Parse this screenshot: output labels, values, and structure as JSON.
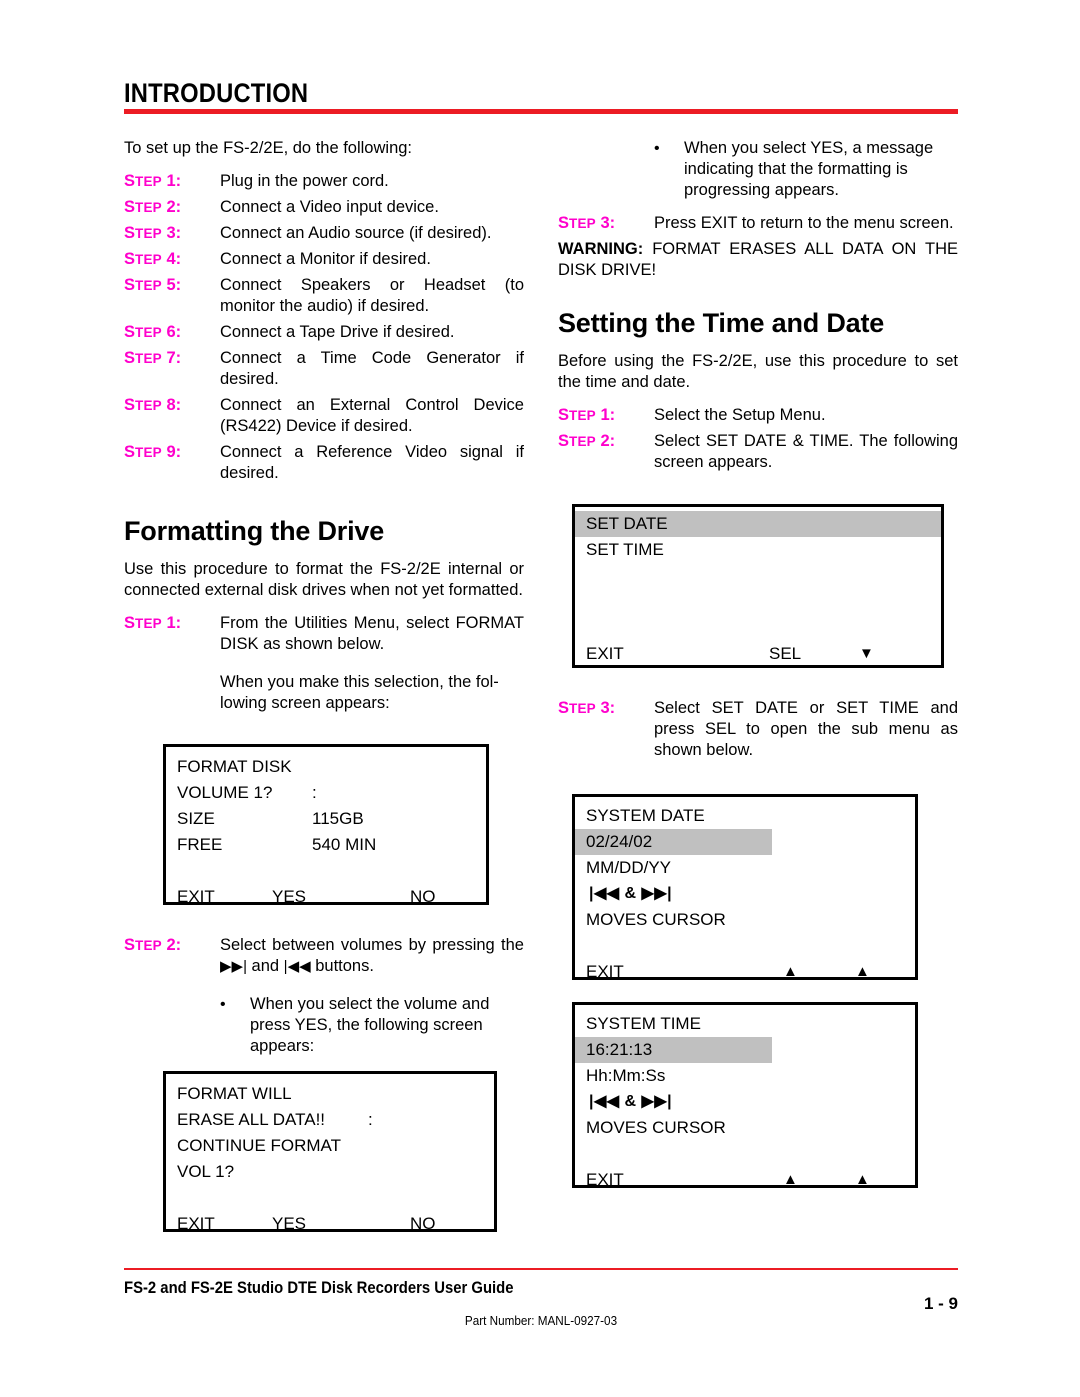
{
  "header": {
    "title": "INTRODUCTION",
    "rule_color": "#ec1c24"
  },
  "colors": {
    "step_magenta": "#ff00cc",
    "rule_red": "#ec1c24",
    "lcd_highlight": "#c0c0c0"
  },
  "left_column": {
    "intro_text": "To set up the FS-2/2E, do the following:",
    "setup_steps": [
      {
        "label_s": "S",
        "label_rest": "TEP",
        "num": "1:",
        "text": "Plug in the power cord."
      },
      {
        "label_s": "S",
        "label_rest": "TEP",
        "num": "2:",
        "text": "Connect a Video input device."
      },
      {
        "label_s": "S",
        "label_rest": "TEP",
        "num": "3:",
        "text": "Connect an Audio source (if desired)."
      },
      {
        "label_s": "S",
        "label_rest": "TEP",
        "num": "4:",
        "text": "Connect a Monitor if desired."
      },
      {
        "label_s": "S",
        "label_rest": "TEP",
        "num": "5:",
        "text": "Connect Speakers or Headset (to monitor the audio) if desired."
      },
      {
        "label_s": "S",
        "label_rest": "TEP",
        "num": "6:",
        "text": "Connect a Tape Drive if desired."
      },
      {
        "label_s": "S",
        "label_rest": "TEP",
        "num": "7:",
        "text": "Connect a Time Code Generator if desired."
      },
      {
        "label_s": "S",
        "label_rest": "TEP",
        "num": "8:",
        "text": "Connect an External Control Device (RS422) Device if desired."
      },
      {
        "label_s": "S",
        "label_rest": "TEP",
        "num": "9:",
        "text": "Connect a Reference Video signal if desired."
      }
    ],
    "formatting_heading": "Formatting the Drive",
    "formatting_intro": "Use this procedure to format the FS-2/2E internal or connected external disk drives when not yet formatted.",
    "format_step1": {
      "label_s": "S",
      "label_rest": "TEP",
      "num": "1:",
      "text": "From the Utilities Menu, select FORMAT DISK as shown below.",
      "continuation": "When you make this selection, the fol-lowing screen appears:"
    },
    "format_disk_screen": {
      "title": "FORMAT DISK",
      "rows": [
        {
          "c1": "VOLUME 1?",
          "c2": ":",
          "c3": ""
        },
        {
          "c1": "SIZE",
          "c2": "115GB",
          "c3": ""
        },
        {
          "c1": "FREE",
          "c2": "540 MIN",
          "c3": ""
        }
      ],
      "buttons": {
        "exit": "EXIT",
        "yes": "YES",
        "no": "NO"
      }
    },
    "format_step2": {
      "label_s": "S",
      "label_rest": "TEP",
      "num": "2:",
      "text_a": "Select between volumes by pressing the ",
      "fwd_glyph": "▶▶|",
      "text_b": " and ",
      "rew_glyph": "|◀◀",
      "text_c": " buttons.",
      "bullet": "When you select the volume and press YES, the following screen appears:"
    },
    "format_will_screen": {
      "rows": [
        {
          "c1": "FORMAT WILL",
          "c2": "",
          "c3": ""
        },
        {
          "c1": "ERASE ALL DATA!!",
          "c2": ":",
          "c3": ""
        },
        {
          "c1": "CONTINUE FORMAT",
          "c2": "",
          "c3": ""
        },
        {
          "c1": "VOL 1?",
          "c2": "",
          "c3": ""
        }
      ],
      "buttons": {
        "exit": "EXIT",
        "yes": "YES",
        "no": "NO"
      }
    }
  },
  "right_column": {
    "top_bullet": "When you select YES, a message indicating that the formatting is progressing appears.",
    "format_step3": {
      "label_s": "S",
      "label_rest": "TEP",
      "num": "3:",
      "text": "Press EXIT to return to the menu screen."
    },
    "warning_label": "WARNING:",
    "warning_text": " FORMAT ERASES ALL DATA ON THE DISK DRIVE!",
    "time_heading": "Setting the Time and Date",
    "time_intro": "Before using the FS-2/2E, use this procedure to set the time and date.",
    "time_steps": [
      {
        "label_s": "S",
        "label_rest": "TEP",
        "num": "1:",
        "text": "Select the Setup Menu."
      },
      {
        "label_s": "S",
        "label_rest": "TEP",
        "num": "2:",
        "text": "Select SET DATE & TIME. The following screen appears."
      }
    ],
    "set_date_screen": {
      "row_selected": "SET DATE",
      "row_second": "SET TIME",
      "buttons": {
        "exit": "EXIT",
        "sel": "SEL",
        "arrow": "▼"
      }
    },
    "time_step3": {
      "label_s": "S",
      "label_rest": "TEP",
      "num": "3:",
      "text": "Select SET DATE or SET TIME and press SEL to open the sub menu as shown below."
    },
    "system_date_screen": {
      "title": "SYSTEM DATE",
      "value": "02/24/02",
      "format_hint": "MM/DD/YY",
      "cursor_glyph": "|◀◀  & ▶▶|",
      "cursor_text": "MOVES CURSOR",
      "buttons": {
        "exit": "EXIT",
        "up1": "▲",
        "up2": "▲"
      }
    },
    "system_time_screen": {
      "title": "SYSTEM TIME",
      "value": "16:21:13",
      "format_hint": "Hh:Mm:Ss",
      "cursor_glyph": "|◀◀  & ▶▶|",
      "cursor_text": "MOVES CURSOR",
      "buttons": {
        "exit": "EXIT",
        "up1": "▲",
        "up2": "▲"
      }
    }
  },
  "footer": {
    "title": "FS-2 and FS-2E Studio DTE Disk Recorders User Guide",
    "page": "1 - 9",
    "part_number": "Part Number: MANL-0927-03"
  }
}
